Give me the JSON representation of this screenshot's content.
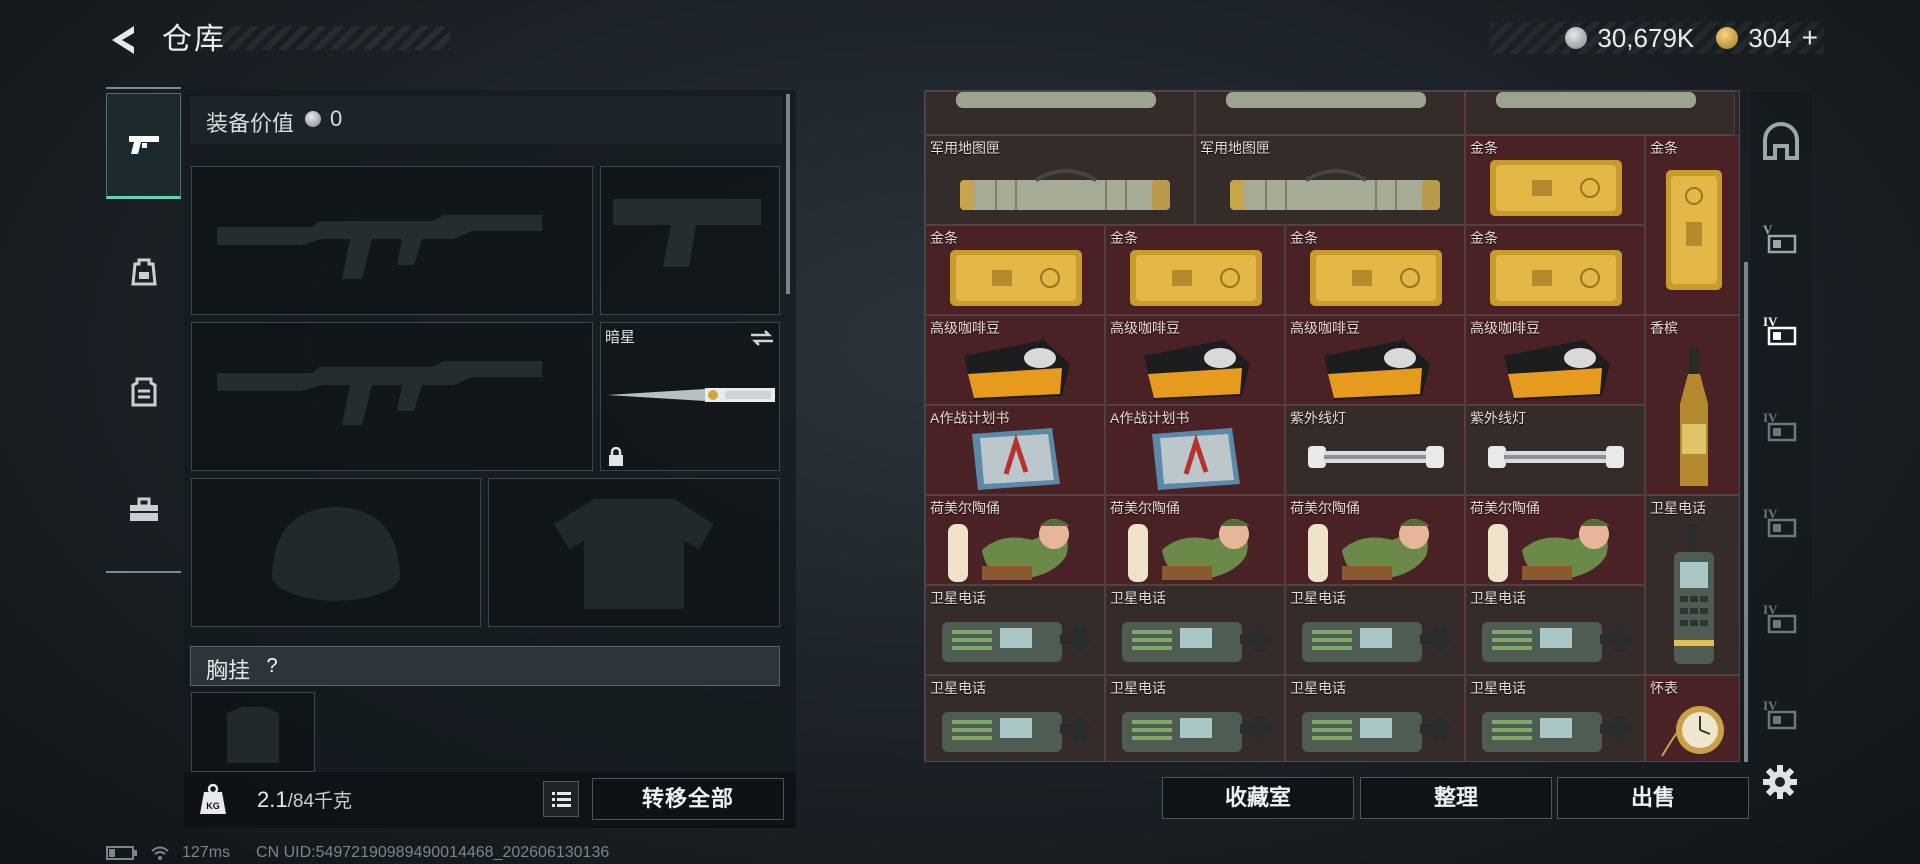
{
  "header": {
    "title": "仓库"
  },
  "currency": {
    "silver": "30,679K",
    "gold": "304",
    "gold_add": "+"
  },
  "equipment": {
    "value_label": "装备价值",
    "value": "0",
    "melee_slot_name": "暗星",
    "chest_label": "胸挂",
    "chest_help": "?"
  },
  "weight": {
    "current": "2.1",
    "max": "/84千克",
    "icon": "KG"
  },
  "buttons": {
    "transfer_all": "转移全部",
    "collection": "收藏室",
    "organize": "整理",
    "sell": "出售"
  },
  "status": {
    "ping": "127ms",
    "uid": "CN UID:549721909894900144​68_202606130136"
  },
  "left_tabs": [
    {
      "icon": "pistol-icon"
    },
    {
      "icon": "backpack-icon"
    },
    {
      "icon": "vest-icon"
    },
    {
      "icon": "toolbox-icon"
    }
  ],
  "right_tabs": [
    {
      "icon": "safe-icon"
    },
    {
      "icon": "storage-v-icon",
      "label": "V"
    },
    {
      "icon": "storage-iv-icon",
      "label": "IV"
    },
    {
      "icon": "storage-iv-icon",
      "label": "IV"
    },
    {
      "icon": "storage-iv-icon",
      "label": "IV"
    },
    {
      "icon": "storage-iv-icon",
      "label": "IV"
    },
    {
      "icon": "storage-iv-icon",
      "label": "IV"
    }
  ],
  "grid": {
    "row1": [
      "军用地图匣",
      "军用地图匣",
      "金条",
      "金条"
    ],
    "row2": [
      "金条",
      "金条",
      "金条",
      "金条"
    ],
    "row3": [
      "高级咖啡豆",
      "高级咖啡豆",
      "高级咖啡豆",
      "高级咖啡豆",
      "香槟"
    ],
    "row4": [
      "A作战计划书",
      "A作战计划书",
      "紫外线灯",
      "紫外线灯"
    ],
    "row5": [
      "荷美尔陶俑",
      "荷美尔陶俑",
      "荷美尔陶俑",
      "荷美尔陶俑",
      "卫星电话"
    ],
    "row6": [
      "卫星电话",
      "卫星电话",
      "卫星电话",
      "卫星电话"
    ],
    "row7": [
      "卫星电话",
      "卫星电话",
      "卫星电话",
      "卫星电话",
      "怀表"
    ]
  }
}
